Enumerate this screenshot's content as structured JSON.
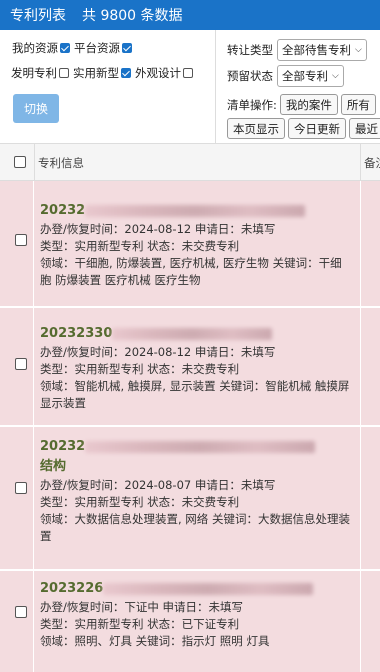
{
  "header": {
    "title": "专利列表",
    "total": "共 9800 条数据"
  },
  "filters": {
    "my_resources": "我的资源",
    "platform_resources": "平台资源",
    "invention": "发明专利",
    "utility": "实用新型",
    "design": "外观设计",
    "switch_label": "切换"
  },
  "panel": {
    "transfer_type_label": "转让类型",
    "transfer_type_value": "全部待售专利",
    "reserve_status_label": "预留状态",
    "reserve_status_value": "全部专利",
    "ops_label": "清单操作:",
    "my_cases": "我的案件",
    "all_partial": "所有",
    "page_show": "本页显示",
    "today_update": "今日更新",
    "latest_partial": "最近"
  },
  "table": {
    "col_info": "专利信息",
    "col_note": "备注"
  },
  "rows": [
    {
      "title_visible": "20232",
      "l1": "办登/恢复时间：2024-08-12 申请日：未填写",
      "l2": "类型：实用新型专利 状态：未交费专利",
      "l3": "领域：干细胞, 防爆装置, 医疗机械, 医疗生物 关键词：干细",
      "l4": "胞 防爆装置 医疗机械 医疗生物"
    },
    {
      "title_visible": "20232330",
      "l1": "办登/恢复时间：2024-08-12 申请日：未填写",
      "l2": "类型：实用新型专利 状态：未交费专利",
      "l3": "领域：智能机械, 触摸屏, 显示装置 关键词：智能机械 触摸屏",
      "l4": "显示装置"
    },
    {
      "title_visible": "20232",
      "title_line2": "结构",
      "l1": "办登/恢复时间：2024-08-07 申请日：未填写",
      "l2": "类型：实用新型专利 状态：未交费专利",
      "l3": "领域：大数据信息处理装置, 网络 关键词：大数据信息处理装",
      "l4": "置"
    },
    {
      "title_visible": "2023226",
      "l1": "办登/恢复时间：下证中 申请日：未填写",
      "l2": "类型：实用新型专利 状态：已下证专利",
      "l3": "领域：照明、灯具 关键词：指示灯 照明 灯具"
    }
  ]
}
